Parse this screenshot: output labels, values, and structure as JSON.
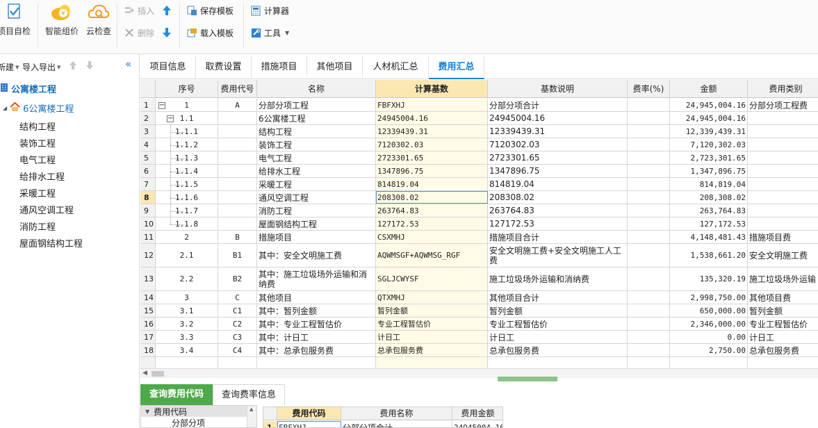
{
  "toolbar": {
    "self_check": "项目自检",
    "smart_price": "智能组价",
    "cloud_check": "云检查",
    "insert": "插入",
    "delete": "删除",
    "save_template": "保存模板",
    "load_template": "载入模板",
    "calculator": "计算器",
    "tools": "工具"
  },
  "left_panel": {
    "new_label": "新建",
    "import_export": "导入导出",
    "root": "公寓楼工程",
    "unit": "6公寓楼工程",
    "items": [
      "结构工程",
      "装饰工程",
      "电气工程",
      "给排水工程",
      "采暖工程",
      "通风空调工程",
      "消防工程",
      "屋面钢结构工程"
    ]
  },
  "tabs": [
    "项目信息",
    "取费设置",
    "措施项目",
    "其他项目",
    "人材机汇总",
    "费用汇总"
  ],
  "active_tab": "费用汇总",
  "grid": {
    "headers": [
      "序号",
      "费用代号",
      "名称",
      "计算基数",
      "基数说明",
      "费率(%)",
      "金额",
      "费用类别"
    ],
    "selected_header": "计算基数",
    "current_row": "8",
    "rows": [
      {
        "rn": "1",
        "seq": "1",
        "code": "A",
        "name": "分部分项工程",
        "base": "FBFXHJ",
        "desc": "分部分项合计",
        "rate": "",
        "amount": "24,945,004.16",
        "cat": "分部分项工程费",
        "level": 0,
        "box": "−"
      },
      {
        "rn": "2",
        "seq": "1.1",
        "code": "",
        "name": "6公寓楼工程",
        "base": "24945004.16",
        "desc": "24945004.16",
        "rate": "",
        "amount": "24,945,004.16",
        "cat": "",
        "level": 1,
        "box": "−"
      },
      {
        "rn": "3",
        "seq": "1.1.1",
        "code": "",
        "name": "结构工程",
        "base": "12339439.31",
        "desc": "12339439.31",
        "rate": "",
        "amount": "12,339,439.31",
        "cat": "",
        "level": 2,
        "box": ""
      },
      {
        "rn": "4",
        "seq": "1.1.2",
        "code": "",
        "name": "装饰工程",
        "base": "7120302.03",
        "desc": "7120302.03",
        "rate": "",
        "amount": "7,120,302.03",
        "cat": "",
        "level": 2,
        "box": ""
      },
      {
        "rn": "5",
        "seq": "1.1.3",
        "code": "",
        "name": "电气工程",
        "base": "2723301.65",
        "desc": "2723301.65",
        "rate": "",
        "amount": "2,723,301.65",
        "cat": "",
        "level": 2,
        "box": ""
      },
      {
        "rn": "6",
        "seq": "1.1.4",
        "code": "",
        "name": "给排水工程",
        "base": "1347896.75",
        "desc": "1347896.75",
        "rate": "",
        "amount": "1,347,896.75",
        "cat": "",
        "level": 2,
        "box": ""
      },
      {
        "rn": "7",
        "seq": "1.1.5",
        "code": "",
        "name": "采暖工程",
        "base": "814819.04",
        "desc": "814819.04",
        "rate": "",
        "amount": "814,819.04",
        "cat": "",
        "level": 2,
        "box": ""
      },
      {
        "rn": "8",
        "seq": "1.1.6",
        "code": "",
        "name": "通风空调工程",
        "base": "208308.02",
        "desc": "208308.02",
        "rate": "",
        "amount": "208,308.02",
        "cat": "",
        "level": 2,
        "box": ""
      },
      {
        "rn": "9",
        "seq": "1.1.7",
        "code": "",
        "name": "消防工程",
        "base": "263764.83",
        "desc": "263764.83",
        "rate": "",
        "amount": "263,764.83",
        "cat": "",
        "level": 2,
        "box": ""
      },
      {
        "rn": "10",
        "seq": "1.1.8",
        "code": "",
        "name": "屋面钢结构工程",
        "base": "127172.53",
        "desc": "127172.53",
        "rate": "",
        "amount": "127,172.53",
        "cat": "",
        "level": 2,
        "box": ""
      },
      {
        "rn": "11",
        "seq": "2",
        "code": "B",
        "name": "措施项目",
        "base": "CSXMHJ",
        "desc": "措施项目合计",
        "rate": "",
        "amount": "4,148,481.43",
        "cat": "措施项目费",
        "level": 0,
        "box": ""
      },
      {
        "rn": "12",
        "seq": "2.1",
        "code": "B1",
        "name": "其中：安全文明施工费",
        "base": "AQWMSGF+AQWMSG_RGF",
        "desc": "安全文明施工费+安全文明施工人工费",
        "rate": "",
        "amount": "1,538,661.20",
        "cat": "安全文明施工费",
        "level": 0,
        "box": ""
      },
      {
        "rn": "13",
        "seq": "2.2",
        "code": "B2",
        "name": "其中：施工垃圾场外运输和消纳费",
        "base": "SGLJCWYSF",
        "desc": "施工垃圾场外运输和消纳费",
        "rate": "",
        "amount": "135,320.19",
        "cat": "施工垃圾场外运输",
        "level": 0,
        "box": ""
      },
      {
        "rn": "14",
        "seq": "3",
        "code": "C",
        "name": "其他项目",
        "base": "QTXMHJ",
        "desc": "其他项目合计",
        "rate": "",
        "amount": "2,998,750.00",
        "cat": "其他项目费",
        "level": 0,
        "box": ""
      },
      {
        "rn": "15",
        "seq": "3.1",
        "code": "C1",
        "name": "其中：暂列金额",
        "base": "暂列金额",
        "desc": "暂列金额",
        "rate": "",
        "amount": "650,000.00",
        "cat": "暂列金额",
        "level": 0,
        "box": ""
      },
      {
        "rn": "16",
        "seq": "3.2",
        "code": "C2",
        "name": "其中：专业工程暂估价",
        "base": "专业工程暂估价",
        "desc": "专业工程暂估价",
        "rate": "",
        "amount": "2,346,000.00",
        "cat": "专业工程暂估价",
        "level": 0,
        "box": ""
      },
      {
        "rn": "17",
        "seq": "3.3",
        "code": "C3",
        "name": "其中：计日工",
        "base": "计日工",
        "desc": "计日工",
        "rate": "",
        "amount": "0.00",
        "cat": "计日工",
        "level": 0,
        "box": ""
      },
      {
        "rn": "18",
        "seq": "3.4",
        "code": "C4",
        "name": "其中：总承包服务费",
        "base": "总承包服务费",
        "desc": "总承包服务费",
        "rate": "",
        "amount": "2,750.00",
        "cat": "总承包服务费",
        "level": 0,
        "box": ""
      }
    ]
  },
  "bottom": {
    "tabs": [
      "查询费用代码",
      "查询费率信息"
    ],
    "tree_root": "费用代码",
    "tree_child": "分部分项",
    "grid_headers": [
      "费用代码",
      "费用名称",
      "费用金额"
    ],
    "grid_row": {
      "rn": "1",
      "code": "FBFXHJ",
      "name": "分部分项合计",
      "amount": "24945004.16"
    }
  },
  "colors": {
    "accent_blue": "#1a7fd2",
    "selected_header": "#fbe7b2",
    "active_bottom_tab": "#4ea94b"
  }
}
